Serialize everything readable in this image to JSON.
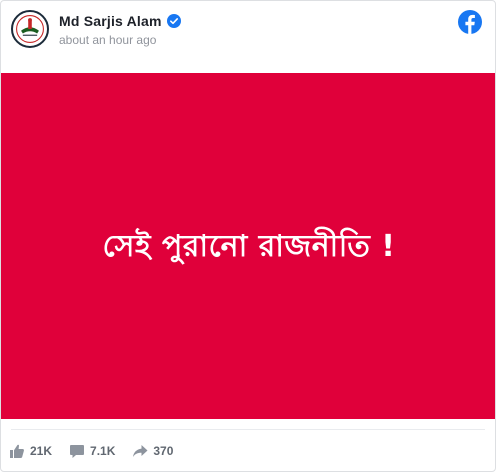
{
  "post": {
    "author": "Md Sarjis Alam",
    "verified": true,
    "timestamp": "about an hour ago",
    "image_text": "সেই পুরানো রাজনীতি !",
    "image_background": "#e0003a"
  },
  "stats": {
    "likes": "21K",
    "comments": "7.1K",
    "shares": "370"
  },
  "icons": {
    "platform": "facebook-icon",
    "verified": "verified-badge-icon",
    "likes": "thumbs-up-icon",
    "comments": "comment-icon",
    "shares": "share-arrow-icon"
  },
  "colors": {
    "facebook_blue": "#1877f2",
    "post_red": "#e0003a",
    "name_text": "#1d2129",
    "meta_text": "#90949c",
    "stat_text": "#606770"
  }
}
